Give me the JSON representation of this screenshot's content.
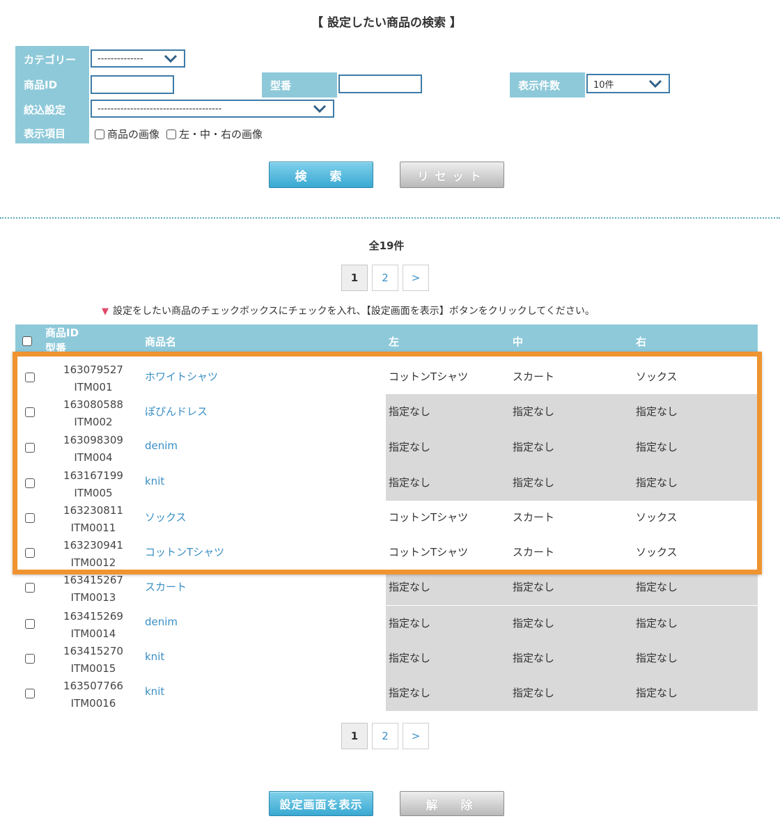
{
  "title": "【 設定したい商品の検索 】",
  "search": {
    "category_label": "カテゴリー",
    "category_value": "--------------",
    "product_id_label": "商品ID",
    "product_id_value": "",
    "model_label": "型番",
    "model_value": "",
    "per_page_label": "表示件数",
    "per_page_value": "10件",
    "filter_label": "絞込設定",
    "filter_value": "--------------------------------------",
    "display_label": "表示項目",
    "option_product_image": "商品の画像",
    "option_lcr_image": "左・中・右の画像",
    "search_button": "検　索",
    "reset_button": "リセット"
  },
  "result_count": "全19件",
  "pagination": {
    "pages": [
      "1",
      "2"
    ],
    "next": ">",
    "current": "1"
  },
  "notice": "設定をしたい商品のチェックボックスにチェックを入れ、【設定画面を表示】ボタンをクリックしてください。",
  "table": {
    "headers": {
      "id": "商品ID",
      "id_sub": "型番",
      "name": "商品名",
      "left": "左",
      "center": "中",
      "right": "右"
    },
    "rows": [
      {
        "id": "163079527",
        "model": "ITM001",
        "name": "ホワイトシャツ",
        "left": "コットンTシャツ",
        "center": "スカート",
        "right": "ソックス",
        "unset": false
      },
      {
        "id": "163080588",
        "model": "ITM002",
        "name": "ぽぴんドレス",
        "left": "指定なし",
        "center": "指定なし",
        "right": "指定なし",
        "unset": true
      },
      {
        "id": "163098309",
        "model": "ITM004",
        "name": "denim",
        "left": "指定なし",
        "center": "指定なし",
        "right": "指定なし",
        "unset": true
      },
      {
        "id": "163167199",
        "model": "ITM005",
        "name": "knit",
        "left": "指定なし",
        "center": "指定なし",
        "right": "指定なし",
        "unset": true
      },
      {
        "id": "163230811",
        "model": "ITM0011",
        "name": "ソックス",
        "left": "コットンTシャツ",
        "center": "スカート",
        "right": "ソックス",
        "unset": false
      },
      {
        "id": "163230941",
        "model": "ITM0012",
        "name": "コットンTシャツ",
        "left": "コットンTシャツ",
        "center": "スカート",
        "right": "ソックス",
        "unset": false
      },
      {
        "id": "163415267",
        "model": "ITM0013",
        "name": "スカート",
        "left": "指定なし",
        "center": "指定なし",
        "right": "指定なし",
        "unset": true
      },
      {
        "id": "163415269",
        "model": "ITM0014",
        "name": "denim",
        "left": "指定なし",
        "center": "指定なし",
        "right": "指定なし",
        "unset": true
      },
      {
        "id": "163415270",
        "model": "ITM0015",
        "name": "knit",
        "left": "指定なし",
        "center": "指定なし",
        "right": "指定なし",
        "unset": true
      },
      {
        "id": "163507766",
        "model": "ITM0016",
        "name": "knit",
        "left": "指定なし",
        "center": "指定なし",
        "right": "指定なし",
        "unset": true
      }
    ]
  },
  "actions": {
    "show_settings": "設定画面を表示",
    "release": "解　除"
  },
  "colors": {
    "header": "#8ec9d9",
    "link": "#3a8fc4",
    "highlight": "#ef9430",
    "unset_bg": "#d9d9d9"
  }
}
